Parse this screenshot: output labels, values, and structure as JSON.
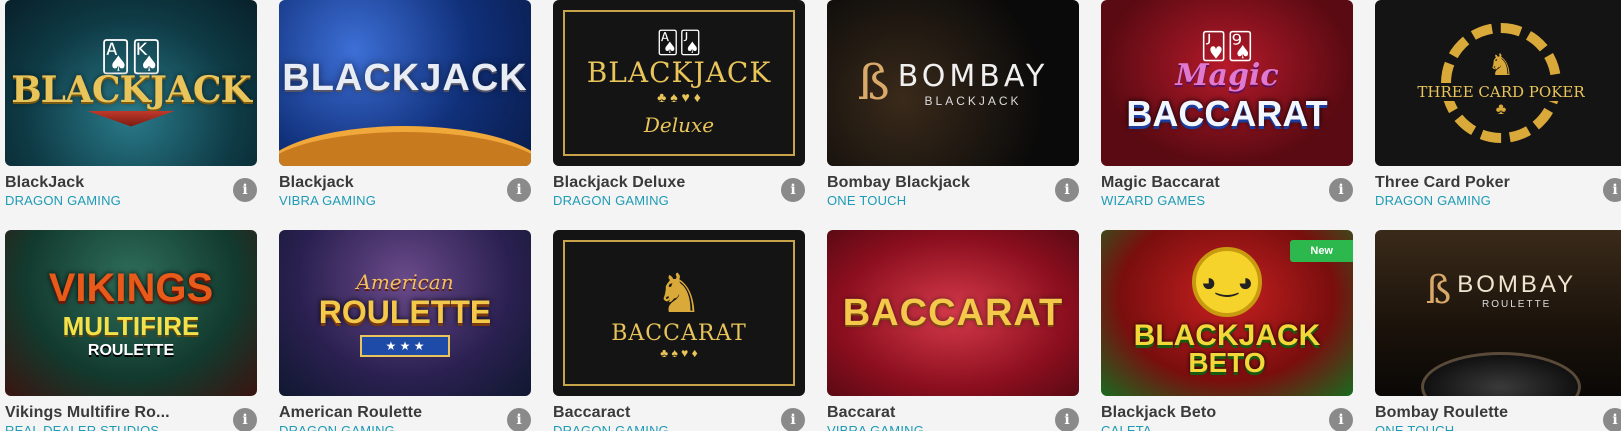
{
  "games": [
    {
      "title": "BlackJack",
      "provider": "DRAGON GAMING",
      "art_text": "BLACKJACK",
      "art_sub": "",
      "icon": "cards-icon",
      "bg": "teal-red",
      "badge": ""
    },
    {
      "title": "Blackjack",
      "provider": "VIBRA GAMING",
      "art_text": "BLACKJACK",
      "art_sub": "",
      "icon": "",
      "bg": "blue-orange",
      "badge": ""
    },
    {
      "title": "Blackjack Deluxe",
      "provider": "DRAGON GAMING",
      "art_text": "BLACKJACK",
      "art_sub": "Deluxe",
      "icon": "card-suits-icon",
      "bg": "black-gold",
      "badge": ""
    },
    {
      "title": "Bombay Blackjack",
      "provider": "ONE TOUCH",
      "art_text": "BOMBAY",
      "art_sub": "BLACKJACK",
      "icon": "bombay-logo-icon",
      "bg": "black",
      "badge": ""
    },
    {
      "title": "Magic Baccarat",
      "provider": "WIZARD GAMES",
      "art_text": "BACCARAT",
      "art_sub": "Magic",
      "icon": "cards-icon",
      "bg": "red",
      "badge": ""
    },
    {
      "title": "Three Card Poker",
      "provider": "DRAGON GAMING",
      "art_text": "THREE CARD POKER",
      "art_sub": "",
      "icon": "dragon-chip-icon",
      "bg": "black-gold",
      "badge": ""
    },
    {
      "title": "Vikings Multifire Ro...",
      "provider": "REAL DEALER STUDIOS",
      "art_text": "VIKINGS",
      "art_sub": "MULTIFIRE",
      "art_sub2": "ROULETTE",
      "icon": "",
      "bg": "green-red",
      "badge": ""
    },
    {
      "title": "American Roulette",
      "provider": "DRAGON GAMING",
      "art_text": "ROULETTE",
      "art_sub": "American",
      "icon": "",
      "bg": "purple-blue",
      "badge": ""
    },
    {
      "title": "Baccaract",
      "provider": "DRAGON GAMING",
      "art_text": "BACCARAT",
      "art_sub": "",
      "icon": "dragon-icon",
      "bg": "black-gold",
      "badge": ""
    },
    {
      "title": "Baccarat",
      "provider": "VIBRA GAMING",
      "art_text": "BACCARAT",
      "art_sub": "",
      "icon": "",
      "bg": "crimson",
      "badge": ""
    },
    {
      "title": "Blackjack Beto",
      "provider": "CALETA",
      "art_text": "BLACKJACK",
      "art_sub": "BETO",
      "icon": "chip-mascot-icon",
      "bg": "green",
      "badge": "New"
    },
    {
      "title": "Bombay Roulette",
      "provider": "ONE TOUCH",
      "art_text": "BOMBAY",
      "art_sub": "ROULETTE",
      "icon": "roulette-wheel-icon",
      "bg": "brown",
      "badge": ""
    }
  ],
  "info_glyph": "i",
  "colors": {
    "provider": "#1e9bb5",
    "badge": "#2db84d",
    "info": "#8a8a8a"
  }
}
